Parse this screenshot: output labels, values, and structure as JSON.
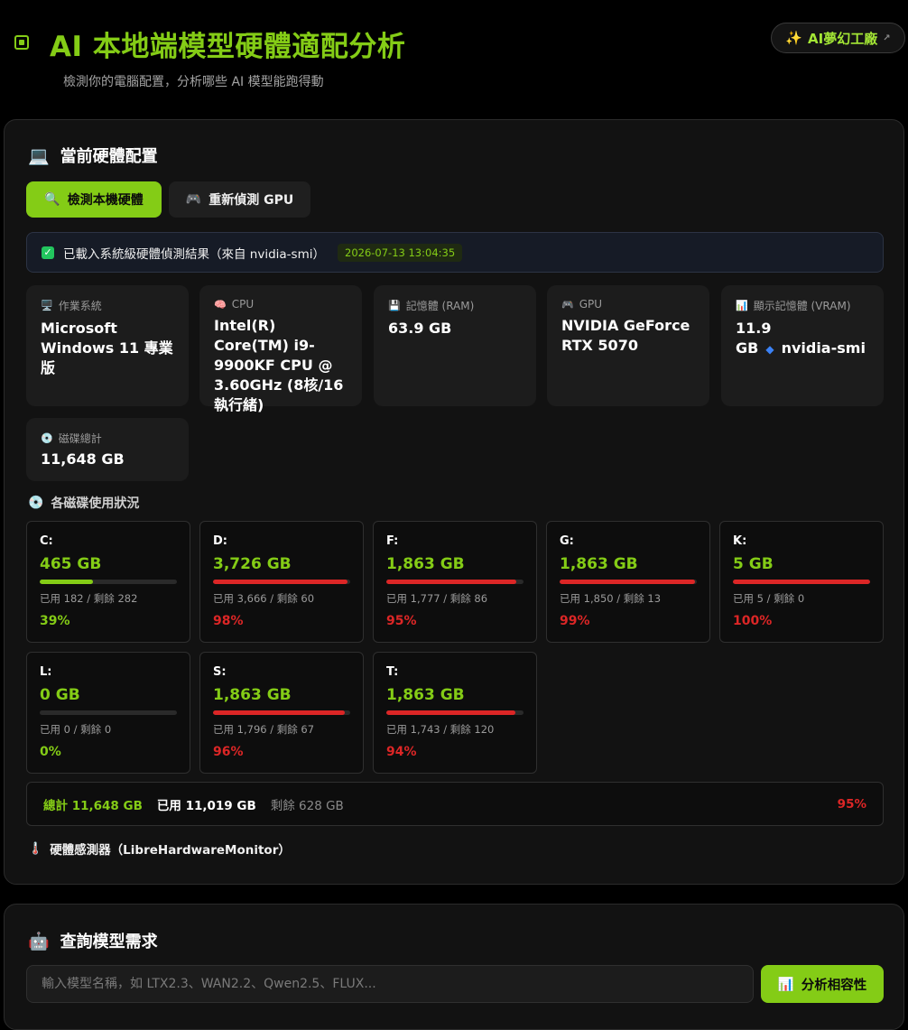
{
  "header": {
    "title": "AI 本地端模型硬體適配分析",
    "subtitle": "檢測你的電腦配置，分析哪些 AI 模型能跑得動",
    "brand_button": "AI夢幻工廠",
    "brand_icon": "✨",
    "brand_ext": "↗"
  },
  "hardware": {
    "title": "當前硬體配置",
    "title_icon": "💻",
    "detect_button": "檢測本機硬體",
    "detect_icon": "🔍",
    "redetect_button": "重新偵測 GPU",
    "redetect_icon": "🎮",
    "status_text": "已載入系統級硬體偵測結果（來自 nvidia-smi）",
    "status_time": "2026-07-13 13:04:35",
    "cards": [
      {
        "icon": "🖥️",
        "label": "作業系統",
        "value": "Microsoft Windows 11 專業版"
      },
      {
        "icon": "🧠",
        "label": "CPU",
        "value": "Intel(R) Core(TM) i9-9900KF CPU @ 3.60GHz (8核/16執行緒)"
      },
      {
        "icon": "💾",
        "label": "記憶體 (RAM)",
        "value": "63.9 GB"
      },
      {
        "icon": "🎮",
        "label": "GPU",
        "value": "NVIDIA GeForce RTX 5070"
      },
      {
        "icon": "📊",
        "label": "顯示記憶體 (VRAM)",
        "value_a": "11.9 GB",
        "diamond": "◆",
        "value_b": "nvidia-smi"
      },
      {
        "icon": "💿",
        "label": "磁碟總計",
        "value": "11,648 GB"
      }
    ],
    "disk_section_label": "各磁碟使用狀況",
    "disk_section_icon": "💿",
    "disks": [
      {
        "name": "C:",
        "size": "465 GB",
        "usage": "已用 182 / 剩餘 282",
        "pct": "39%",
        "fraction": 0.39,
        "level": "ok"
      },
      {
        "name": "D:",
        "size": "3,726 GB",
        "usage": "已用 3,666 / 剩餘 60",
        "pct": "98%",
        "fraction": 0.98,
        "level": "high"
      },
      {
        "name": "F:",
        "size": "1,863 GB",
        "usage": "已用 1,777 / 剩餘 86",
        "pct": "95%",
        "fraction": 0.95,
        "level": "high"
      },
      {
        "name": "G:",
        "size": "1,863 GB",
        "usage": "已用 1,850 / 剩餘 13",
        "pct": "99%",
        "fraction": 0.99,
        "level": "high"
      },
      {
        "name": "K:",
        "size": "5 GB",
        "usage": "已用 5 / 剩餘 0",
        "pct": "100%",
        "fraction": 1.0,
        "level": "high"
      },
      {
        "name": "L:",
        "size": "0 GB",
        "usage": "已用 0 / 剩餘 0",
        "pct": "0%",
        "fraction": 0.0,
        "level": "ok"
      },
      {
        "name": "S:",
        "size": "1,863 GB",
        "usage": "已用 1,796 / 剩餘 67",
        "pct": "96%",
        "fraction": 0.96,
        "level": "high"
      },
      {
        "name": "T:",
        "size": "1,863 GB",
        "usage": "已用 1,743 / 剩餘 120",
        "pct": "94%",
        "fraction": 0.94,
        "level": "high"
      }
    ],
    "totals": {
      "total": "總計 11,648 GB",
      "used": "已用 11,019 GB",
      "free": "剩餘 628 GB",
      "pct": "95%"
    },
    "sensor_label": "硬體感測器（LibreHardwareMonitor）",
    "sensor_icon": "🌡️"
  },
  "query": {
    "title": "查詢模型需求",
    "title_icon": "🤖",
    "placeholder": "輸入模型名稱，如 LTX2.3、WAN2.2、Qwen2.5、FLUX...",
    "analyze_button": "分析相容性",
    "analyze_icon": "📊"
  },
  "colors": {
    "accent": "#84cc16",
    "danger": "#dc2626",
    "ok": "#84cc16"
  }
}
